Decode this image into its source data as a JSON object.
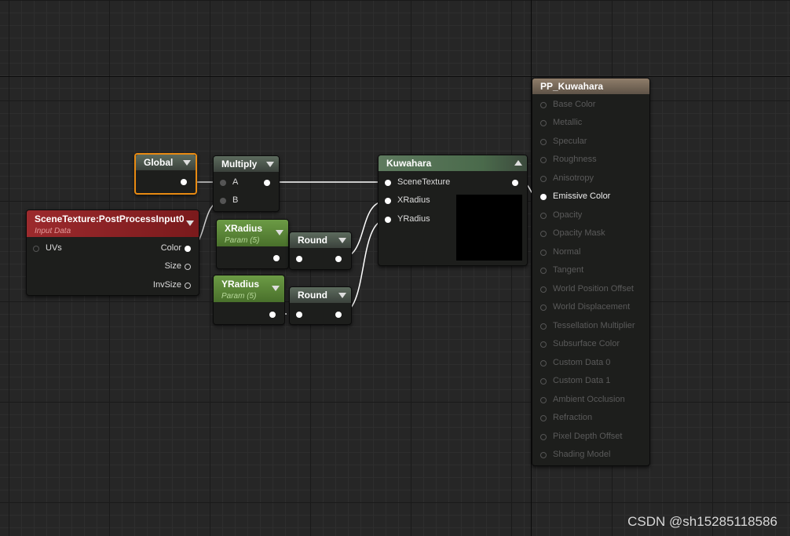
{
  "nodes": {
    "global": {
      "title": "Global"
    },
    "multiply": {
      "title": "Multiply",
      "inputs": [
        "A",
        "B"
      ]
    },
    "scene_texture": {
      "title": "SceneTexture:PostProcessInput0",
      "subtitle": "Input Data",
      "inputs": [
        "UVs"
      ],
      "outputs": [
        "Color",
        "Size",
        "InvSize"
      ]
    },
    "xradius": {
      "title": "XRadius",
      "subtitle": "Param (5)"
    },
    "yradius": {
      "title": "YRadius",
      "subtitle": "Param (5)"
    },
    "round1": {
      "title": "Round"
    },
    "round2": {
      "title": "Round"
    },
    "kuwahara": {
      "title": "Kuwahara",
      "inputs": [
        "SceneTexture",
        "XRadius",
        "YRadius"
      ]
    },
    "material": {
      "title": "PP_Kuwahara",
      "inputs": [
        "Base Color",
        "Metallic",
        "Specular",
        "Roughness",
        "Anisotropy",
        "Emissive Color",
        "Opacity",
        "Opacity Mask",
        "Normal",
        "Tangent",
        "World Position Offset",
        "World Displacement",
        "Tessellation Multiplier",
        "Subsurface Color",
        "Custom Data 0",
        "Custom Data 1",
        "Ambient Occlusion",
        "Refraction",
        "Pixel Depth Offset",
        "Shading Model"
      ],
      "active_input": "Emissive Color"
    }
  },
  "watermark": "CSDN @sh15285118586",
  "colors": {
    "selection": "#e88a12",
    "wire": "#ffffff"
  }
}
